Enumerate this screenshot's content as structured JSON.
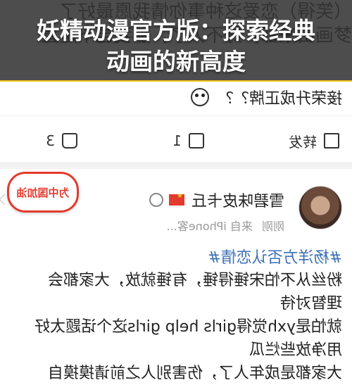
{
  "banner": {
    "title_line1": "妖精动漫官方版：探索经典",
    "title_line2": "动画的新高度",
    "bg_text_1": "梦画出来都，好不人了，那我岂不是直",
    "bg_text_2": "（笑得）恋爱这种事你情我愿最好了"
  },
  "prev_post": {
    "text_tail": "接荣升成正牌？？"
  },
  "actions": {
    "repost_label": "转发",
    "comment_count": "1",
    "like_count": "3"
  },
  "post": {
    "username": "雪碧味皮卡丘",
    "time": "刚刚",
    "source": "来自 iPhone客...",
    "badge_text": "为中国加油",
    "hashtag": "#杨洋方否认恋情#",
    "lines": [
      "粉丝从不怕宋锤得锤，有锤就放，大家都会",
      "理智对待",
      "就怕是yxh觉得girls help girls这个话题太好",
      "用净放些烂瓜",
      "大家都是成年人了，伤害别人之前请摸摸自"
    ]
  },
  "colors": {
    "banner_bg": "#4d4d4d",
    "stripe": "#f2c21a",
    "hashtag": "#3a6fb5",
    "flag": "#e23b2e"
  },
  "icons": [
    "repost-icon",
    "comment-icon",
    "like-icon",
    "emoji-icon",
    "flag-icon",
    "vip-icon",
    "chevron-down-icon"
  ]
}
